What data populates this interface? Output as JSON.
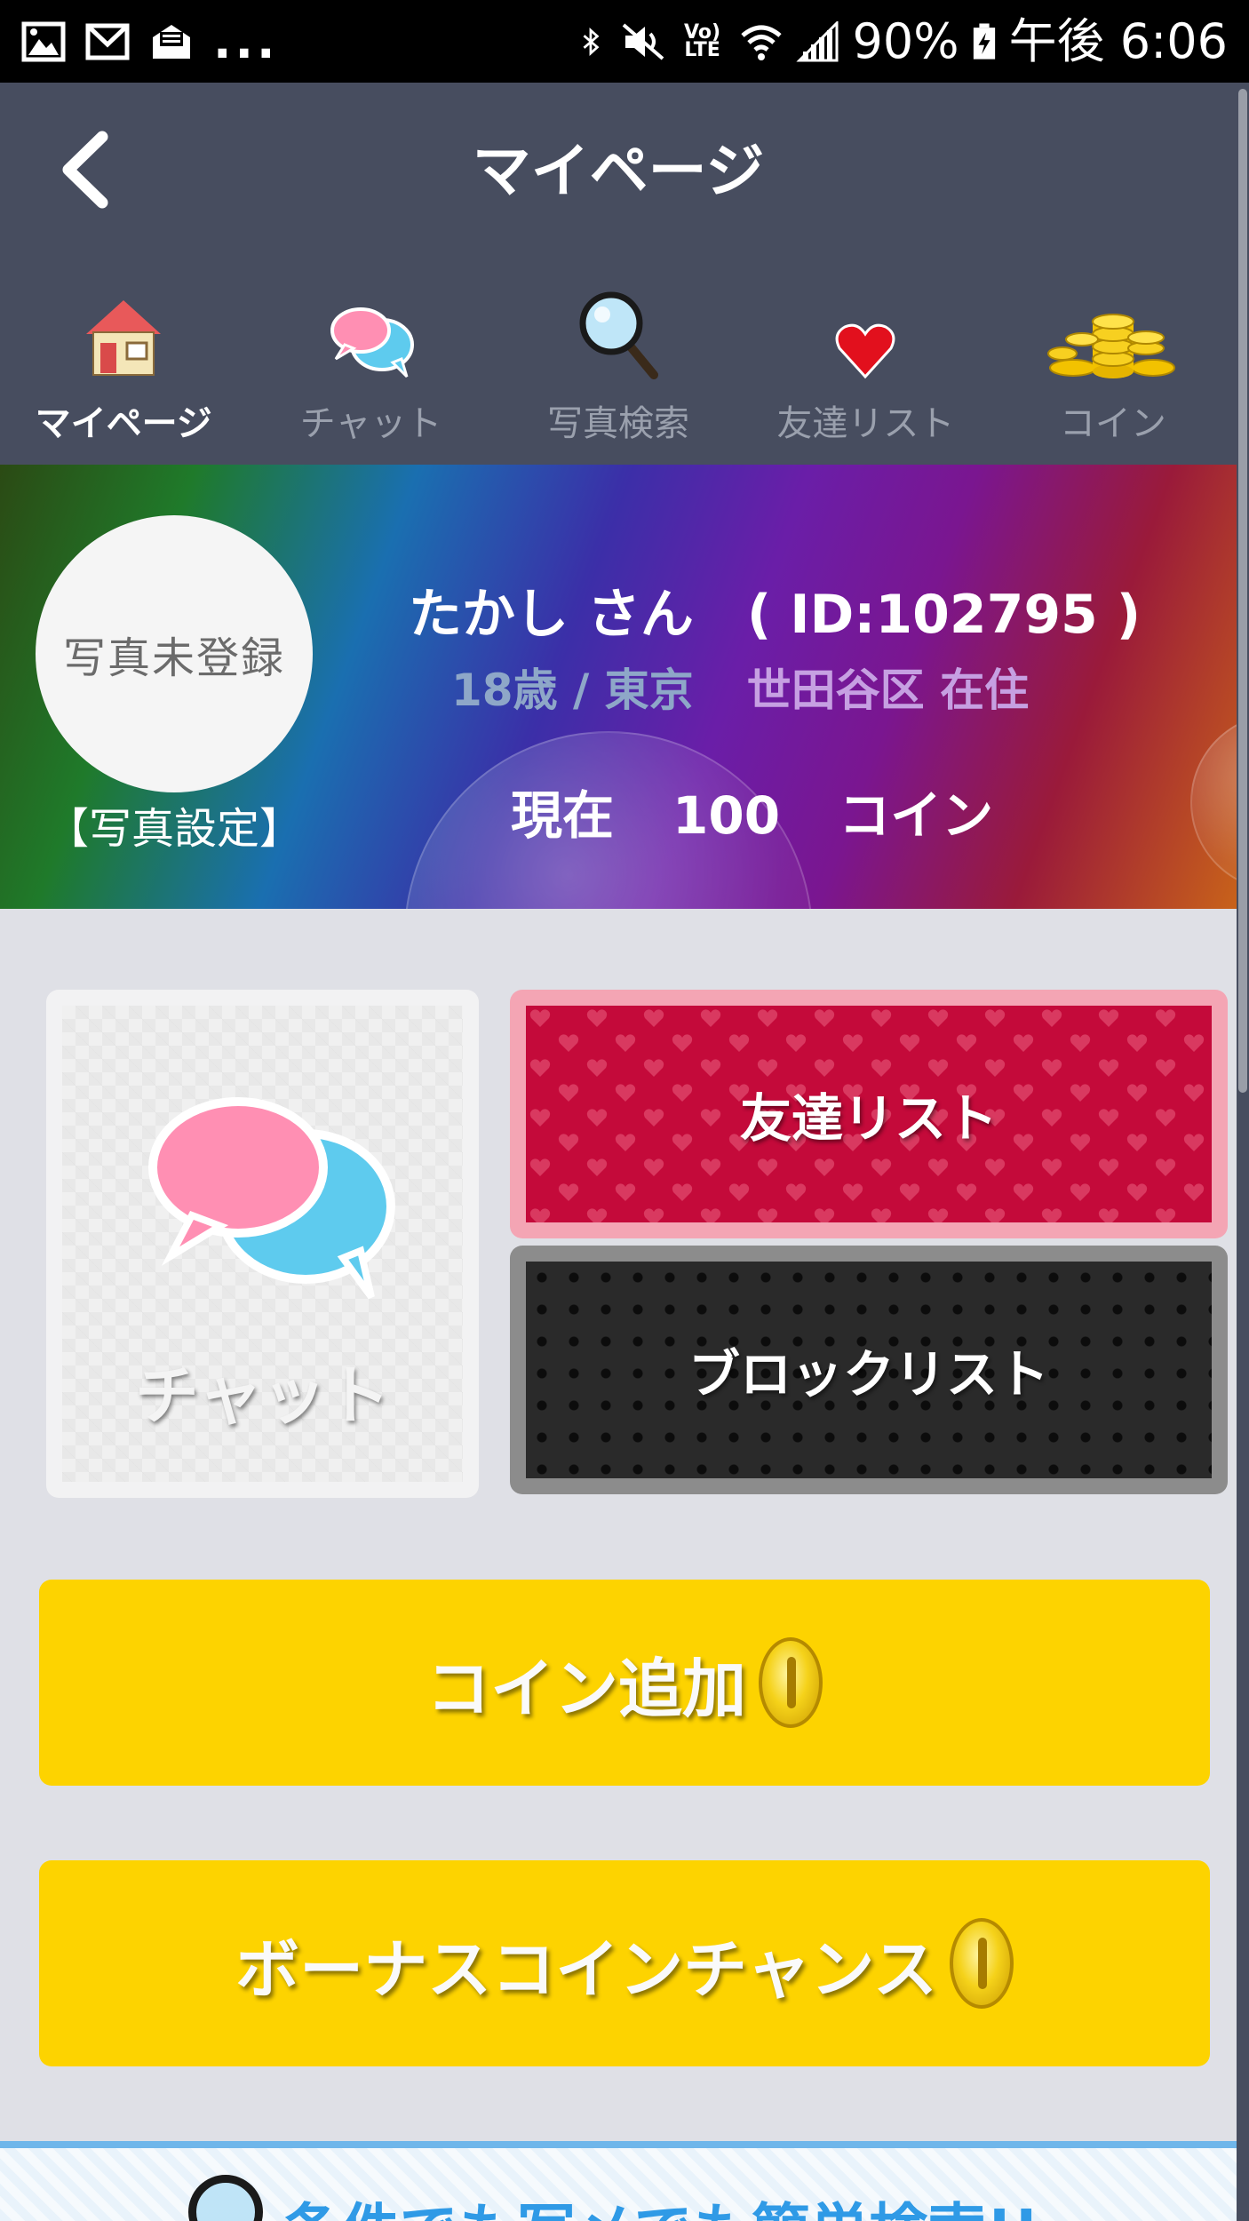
{
  "status_bar": {
    "dots": "...",
    "lte": "Vo) LTE",
    "battery": "90%",
    "time": "午後 6:06"
  },
  "header": {
    "title": "マイページ",
    "back_icon": "chevron-left-icon"
  },
  "nav": {
    "items": [
      {
        "label": "マイページ",
        "icon": "house-icon",
        "active": true
      },
      {
        "label": "チャット",
        "icon": "chat-bubbles-icon",
        "active": false
      },
      {
        "label": "写真検索",
        "icon": "magnifier-icon",
        "active": false
      },
      {
        "label": "友達リスト",
        "icon": "heart-icon",
        "active": false
      },
      {
        "label": "コイン",
        "icon": "coins-icon",
        "active": false
      }
    ]
  },
  "profile": {
    "avatar_text": "写真未登録",
    "photo_setting": "【写真設定】",
    "name_line": "たかし さん　( ID:102795 )",
    "age_pref": "18歳 / 東京",
    "area": "世田谷区 在住",
    "coins_prefix": "現在",
    "coins_value": "100",
    "coins_suffix": "コイン"
  },
  "tiles": {
    "chat": "チャット",
    "friends": "友達リスト",
    "block": "ブロックリスト"
  },
  "buttons": {
    "add_coin": "コイン追加",
    "bonus_coin": "ボーナスコインチャンス"
  },
  "search_banner": {
    "text": "条件でも写メでも簡単検索!!"
  },
  "colors": {
    "header_bg": "#474d5f",
    "page_bg": "#dfe0e6",
    "yellow": "#fdd300",
    "friends_red": "#c40a3a",
    "friends_border": "#f4a5b4",
    "block_bg": "#2a2a2a",
    "search_blue": "#2f9ae6"
  }
}
